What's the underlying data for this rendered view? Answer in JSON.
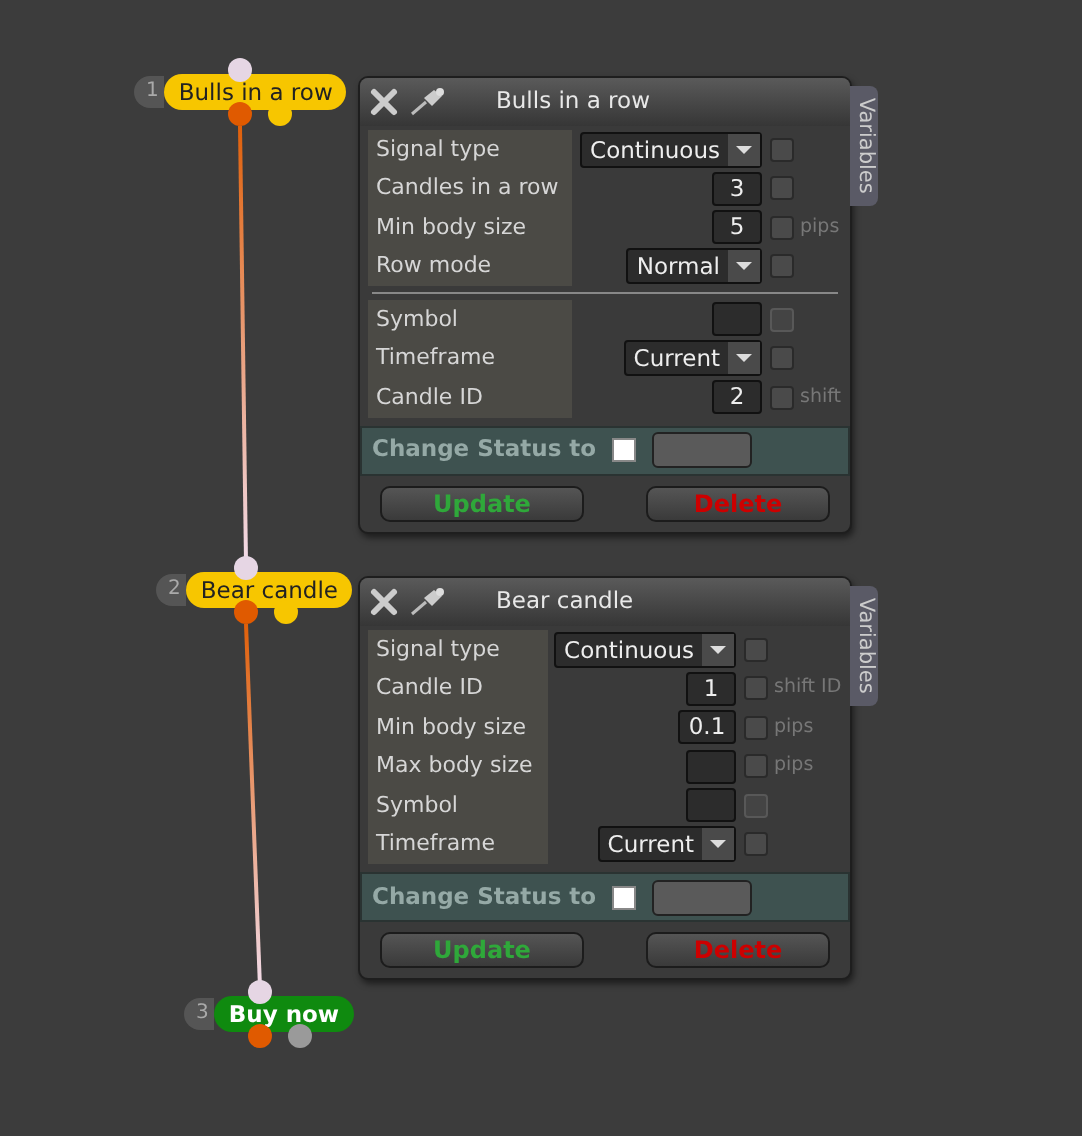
{
  "nodes": [
    {
      "number": "1",
      "label": "Bulls in a row",
      "kind": "condition",
      "color": "#f7c600"
    },
    {
      "number": "2",
      "label": "Bear candle",
      "kind": "condition",
      "color": "#f7c600"
    },
    {
      "number": "3",
      "label": "Buy now",
      "kind": "action",
      "color": "#0f8a0f"
    }
  ],
  "panels": [
    {
      "title": "Bulls in a row",
      "side_tab": "Variables",
      "rows": [
        {
          "kind": "dropdown",
          "label": "Signal type",
          "value": "Continuous",
          "checked": false,
          "disabled": false
        },
        {
          "kind": "number",
          "label": "Candles in a row",
          "value": "3",
          "checked": false,
          "disabled": false
        },
        {
          "kind": "number",
          "label": "Min body size",
          "value": "5",
          "checked": false,
          "disabled": false,
          "suffix": "pips"
        },
        {
          "kind": "dropdown",
          "label": "Row mode",
          "value": "Normal",
          "checked": false,
          "disabled": false
        },
        {
          "kind": "divider"
        },
        {
          "kind": "number",
          "label": "Symbol",
          "checked": false,
          "disabled": true
        },
        {
          "kind": "dropdown",
          "label": "Timeframe",
          "value": "Current",
          "checked": false,
          "disabled": false
        },
        {
          "kind": "number",
          "label": "Candle ID",
          "value": "2",
          "checked": false,
          "disabled": false,
          "suffix": "shift"
        }
      ],
      "status": {
        "label": "Change Status to",
        "checked": false
      },
      "buttons": [
        {
          "label": "Update",
          "kind": "update"
        },
        {
          "label": "Delete",
          "kind": "delete"
        }
      ]
    },
    {
      "title": "Bear candle",
      "side_tab": "Variables",
      "rows": [
        {
          "kind": "dropdown",
          "label": "Signal type",
          "value": "Continuous",
          "checked": false,
          "disabled": false
        },
        {
          "kind": "number",
          "label": "Candle ID",
          "value": "1",
          "checked": false,
          "disabled": false,
          "suffix": "shift ID"
        },
        {
          "kind": "number",
          "label": "Min body size",
          "value": "0.1",
          "checked": false,
          "disabled": false,
          "suffix": "pips"
        },
        {
          "kind": "number",
          "label": "Max body size",
          "checked": false,
          "disabled": false,
          "suffix": "pips"
        },
        {
          "kind": "number",
          "label": "Symbol",
          "checked": false,
          "disabled": true
        },
        {
          "kind": "dropdown",
          "label": "Timeframe",
          "value": "Current",
          "checked": false,
          "disabled": false
        }
      ],
      "status": {
        "label": "Change Status to",
        "checked": false
      },
      "buttons": [
        {
          "label": "Update",
          "kind": "update"
        },
        {
          "label": "Delete",
          "kind": "delete"
        }
      ]
    }
  ]
}
